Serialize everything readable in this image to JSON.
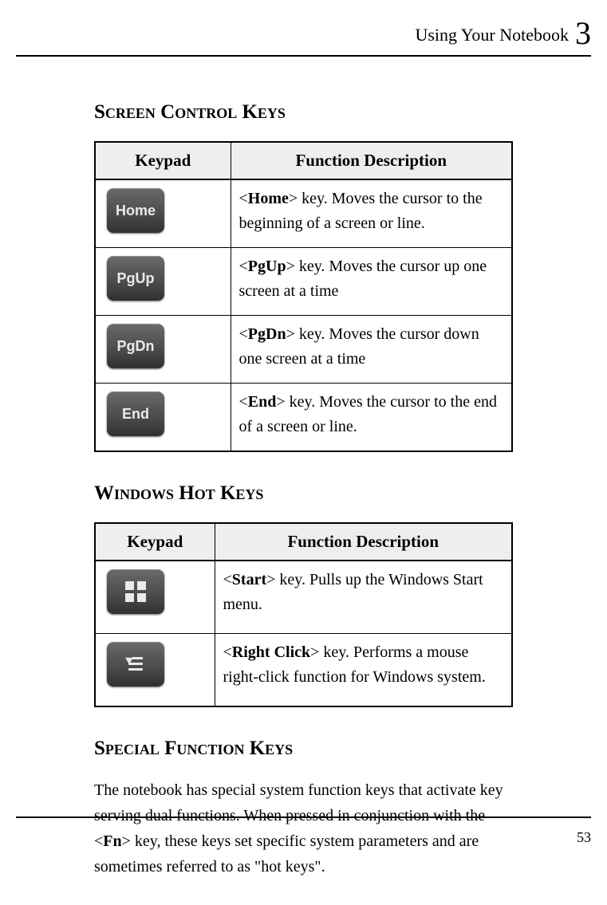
{
  "header": {
    "title": "Using Your Notebook",
    "chapter_number": "3"
  },
  "sections": {
    "screen_control": {
      "title": "Screen Control Keys",
      "columns": {
        "keypad": "Keypad",
        "desc": "Function Description"
      },
      "rows": [
        {
          "key_label": "Home",
          "bold": "Home",
          "rest": "> key. Moves the cursor to the beginning of a screen or line."
        },
        {
          "key_label": "PgUp",
          "bold": "PgUp",
          "rest": "> key. Moves the cursor up one screen at a time"
        },
        {
          "key_label": "PgDn",
          "bold": "PgDn",
          "rest": "> key. Moves the cursor down one screen at a time"
        },
        {
          "key_label": "End",
          "bold": "End",
          "rest": "> key. Moves the cursor to the end of a screen or line."
        }
      ]
    },
    "windows_hot": {
      "title": "Windows Hot Keys",
      "columns": {
        "keypad": "Keypad",
        "desc": "Function Description"
      },
      "rows": [
        {
          "icon": "windows",
          "bold": "Start",
          "rest": "> key. Pulls up the Windows Start menu."
        },
        {
          "icon": "context-menu",
          "bold": "Right Click",
          "rest": "> key. Performs a mouse right-click function for Windows system."
        }
      ]
    },
    "special_function": {
      "title": "Special Function Keys",
      "para_parts": {
        "p1": "The notebook has special system function keys that activate key serving dual functions. When pressed in conjunction with the <",
        "bold": "Fn",
        "p2": "> key, these keys set specific system parameters and are sometimes referred to as \"hot keys\"."
      }
    }
  },
  "page_number": "53"
}
